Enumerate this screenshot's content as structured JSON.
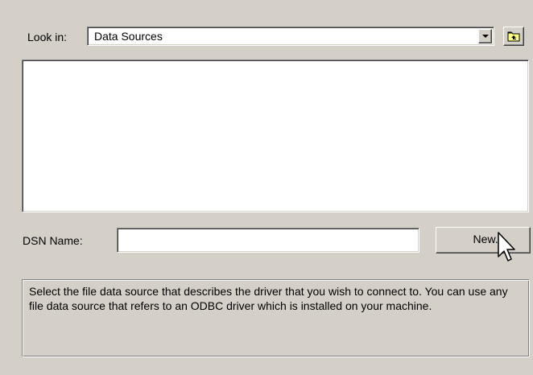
{
  "look_in": {
    "label": "Look in:",
    "value": "Data Sources"
  },
  "file_list": {
    "items": []
  },
  "dsn": {
    "label": "DSN Name:",
    "value": "",
    "new_button": "New..."
  },
  "description": "Select the file data source that describes the driver that you wish to connect to. You can use any file data source that refers to an ODBC driver which is installed on your machine."
}
